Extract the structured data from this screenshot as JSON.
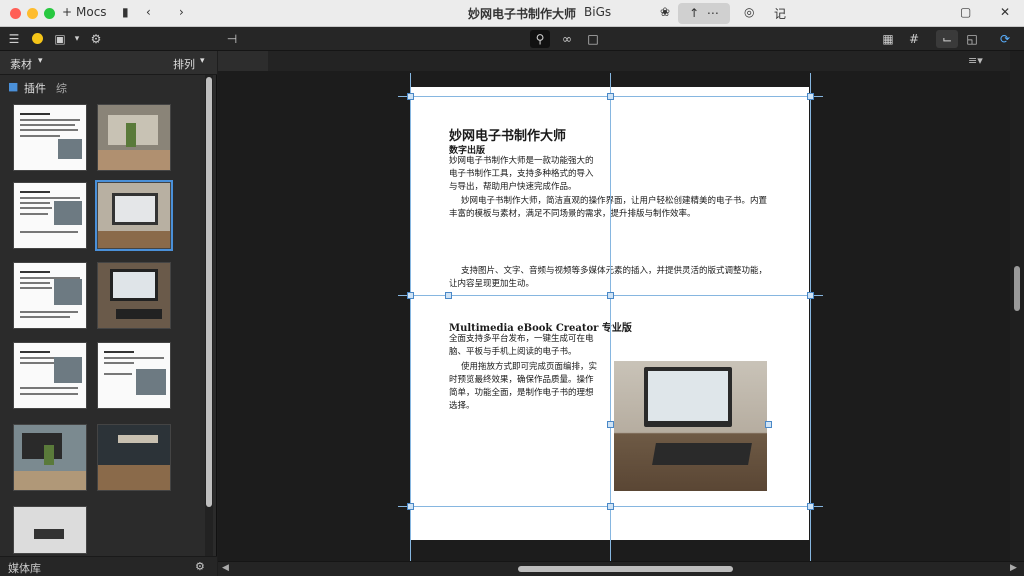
{
  "titlebar": {
    "back_label": "Mocs",
    "doc_title": "妙网电子书制作大师",
    "doc_suffix": "BiGs",
    "extra_label": "记"
  },
  "sidebar": {
    "tab_label": "素材",
    "sort_label": "排列",
    "folder_label": "插件",
    "folder_sub": "综",
    "footer_label": "媒体库"
  },
  "page": {
    "title": "妙网电子书制作大师",
    "subtitle": "数字出版",
    "intro": "妙网电子书制作大师是一款功能强大的电子书制作工具，支持多种格式的导入与导出，帮助用户快速完成作品。",
    "para1": "妙网电子书制作大师，简洁直观的操作界面，让用户轻松创建精美的电子书。内置丰富的模板与素材，满足不同场景的需求，提升排版与制作效率。",
    "para2": "支持图片、文字、音频与视频等多媒体元素的插入，并提供灵活的版式调整功能，让内容呈现更加生动。",
    "section_title": "Multimedia eBook Creator 专业版",
    "section_body": "全面支持多平台发布，一键生成可在电脑、平板与手机上阅读的电子书。",
    "para3": "使用拖放方式即可完成页面编排，实时预览最终效果，确保作品质量。操作简单，功能全面，是制作电子书的理想选择。"
  },
  "colors": {
    "accent": "#4a90d9",
    "guide": "#86b6e0",
    "traffic_close": "#ff5f57",
    "traffic_min": "#febc2e",
    "traffic_max": "#28c840"
  }
}
